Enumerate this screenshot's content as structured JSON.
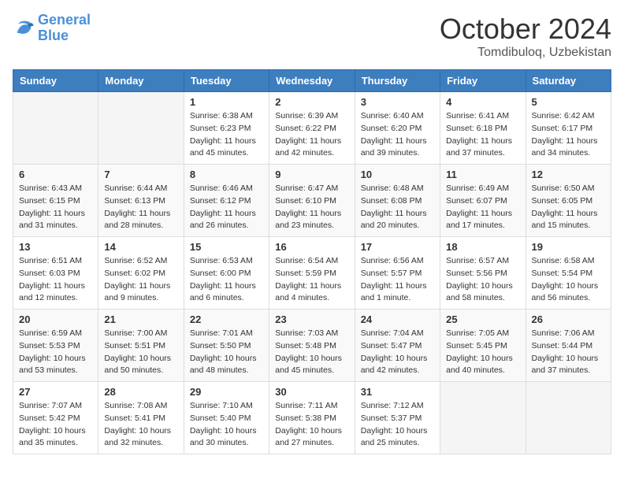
{
  "header": {
    "logo_line1": "General",
    "logo_line2": "Blue",
    "month": "October 2024",
    "location": "Tomdibuloq, Uzbekistan"
  },
  "weekdays": [
    "Sunday",
    "Monday",
    "Tuesday",
    "Wednesday",
    "Thursday",
    "Friday",
    "Saturday"
  ],
  "weeks": [
    [
      {
        "day": null
      },
      {
        "day": null
      },
      {
        "day": "1",
        "sunrise": "Sunrise: 6:38 AM",
        "sunset": "Sunset: 6:23 PM",
        "daylight": "Daylight: 11 hours and 45 minutes."
      },
      {
        "day": "2",
        "sunrise": "Sunrise: 6:39 AM",
        "sunset": "Sunset: 6:22 PM",
        "daylight": "Daylight: 11 hours and 42 minutes."
      },
      {
        "day": "3",
        "sunrise": "Sunrise: 6:40 AM",
        "sunset": "Sunset: 6:20 PM",
        "daylight": "Daylight: 11 hours and 39 minutes."
      },
      {
        "day": "4",
        "sunrise": "Sunrise: 6:41 AM",
        "sunset": "Sunset: 6:18 PM",
        "daylight": "Daylight: 11 hours and 37 minutes."
      },
      {
        "day": "5",
        "sunrise": "Sunrise: 6:42 AM",
        "sunset": "Sunset: 6:17 PM",
        "daylight": "Daylight: 11 hours and 34 minutes."
      }
    ],
    [
      {
        "day": "6",
        "sunrise": "Sunrise: 6:43 AM",
        "sunset": "Sunset: 6:15 PM",
        "daylight": "Daylight: 11 hours and 31 minutes."
      },
      {
        "day": "7",
        "sunrise": "Sunrise: 6:44 AM",
        "sunset": "Sunset: 6:13 PM",
        "daylight": "Daylight: 11 hours and 28 minutes."
      },
      {
        "day": "8",
        "sunrise": "Sunrise: 6:46 AM",
        "sunset": "Sunset: 6:12 PM",
        "daylight": "Daylight: 11 hours and 26 minutes."
      },
      {
        "day": "9",
        "sunrise": "Sunrise: 6:47 AM",
        "sunset": "Sunset: 6:10 PM",
        "daylight": "Daylight: 11 hours and 23 minutes."
      },
      {
        "day": "10",
        "sunrise": "Sunrise: 6:48 AM",
        "sunset": "Sunset: 6:08 PM",
        "daylight": "Daylight: 11 hours and 20 minutes."
      },
      {
        "day": "11",
        "sunrise": "Sunrise: 6:49 AM",
        "sunset": "Sunset: 6:07 PM",
        "daylight": "Daylight: 11 hours and 17 minutes."
      },
      {
        "day": "12",
        "sunrise": "Sunrise: 6:50 AM",
        "sunset": "Sunset: 6:05 PM",
        "daylight": "Daylight: 11 hours and 15 minutes."
      }
    ],
    [
      {
        "day": "13",
        "sunrise": "Sunrise: 6:51 AM",
        "sunset": "Sunset: 6:03 PM",
        "daylight": "Daylight: 11 hours and 12 minutes."
      },
      {
        "day": "14",
        "sunrise": "Sunrise: 6:52 AM",
        "sunset": "Sunset: 6:02 PM",
        "daylight": "Daylight: 11 hours and 9 minutes."
      },
      {
        "day": "15",
        "sunrise": "Sunrise: 6:53 AM",
        "sunset": "Sunset: 6:00 PM",
        "daylight": "Daylight: 11 hours and 6 minutes."
      },
      {
        "day": "16",
        "sunrise": "Sunrise: 6:54 AM",
        "sunset": "Sunset: 5:59 PM",
        "daylight": "Daylight: 11 hours and 4 minutes."
      },
      {
        "day": "17",
        "sunrise": "Sunrise: 6:56 AM",
        "sunset": "Sunset: 5:57 PM",
        "daylight": "Daylight: 11 hours and 1 minute."
      },
      {
        "day": "18",
        "sunrise": "Sunrise: 6:57 AM",
        "sunset": "Sunset: 5:56 PM",
        "daylight": "Daylight: 10 hours and 58 minutes."
      },
      {
        "day": "19",
        "sunrise": "Sunrise: 6:58 AM",
        "sunset": "Sunset: 5:54 PM",
        "daylight": "Daylight: 10 hours and 56 minutes."
      }
    ],
    [
      {
        "day": "20",
        "sunrise": "Sunrise: 6:59 AM",
        "sunset": "Sunset: 5:53 PM",
        "daylight": "Daylight: 10 hours and 53 minutes."
      },
      {
        "day": "21",
        "sunrise": "Sunrise: 7:00 AM",
        "sunset": "Sunset: 5:51 PM",
        "daylight": "Daylight: 10 hours and 50 minutes."
      },
      {
        "day": "22",
        "sunrise": "Sunrise: 7:01 AM",
        "sunset": "Sunset: 5:50 PM",
        "daylight": "Daylight: 10 hours and 48 minutes."
      },
      {
        "day": "23",
        "sunrise": "Sunrise: 7:03 AM",
        "sunset": "Sunset: 5:48 PM",
        "daylight": "Daylight: 10 hours and 45 minutes."
      },
      {
        "day": "24",
        "sunrise": "Sunrise: 7:04 AM",
        "sunset": "Sunset: 5:47 PM",
        "daylight": "Daylight: 10 hours and 42 minutes."
      },
      {
        "day": "25",
        "sunrise": "Sunrise: 7:05 AM",
        "sunset": "Sunset: 5:45 PM",
        "daylight": "Daylight: 10 hours and 40 minutes."
      },
      {
        "day": "26",
        "sunrise": "Sunrise: 7:06 AM",
        "sunset": "Sunset: 5:44 PM",
        "daylight": "Daylight: 10 hours and 37 minutes."
      }
    ],
    [
      {
        "day": "27",
        "sunrise": "Sunrise: 7:07 AM",
        "sunset": "Sunset: 5:42 PM",
        "daylight": "Daylight: 10 hours and 35 minutes."
      },
      {
        "day": "28",
        "sunrise": "Sunrise: 7:08 AM",
        "sunset": "Sunset: 5:41 PM",
        "daylight": "Daylight: 10 hours and 32 minutes."
      },
      {
        "day": "29",
        "sunrise": "Sunrise: 7:10 AM",
        "sunset": "Sunset: 5:40 PM",
        "daylight": "Daylight: 10 hours and 30 minutes."
      },
      {
        "day": "30",
        "sunrise": "Sunrise: 7:11 AM",
        "sunset": "Sunset: 5:38 PM",
        "daylight": "Daylight: 10 hours and 27 minutes."
      },
      {
        "day": "31",
        "sunrise": "Sunrise: 7:12 AM",
        "sunset": "Sunset: 5:37 PM",
        "daylight": "Daylight: 10 hours and 25 minutes."
      },
      {
        "day": null
      },
      {
        "day": null
      }
    ]
  ]
}
